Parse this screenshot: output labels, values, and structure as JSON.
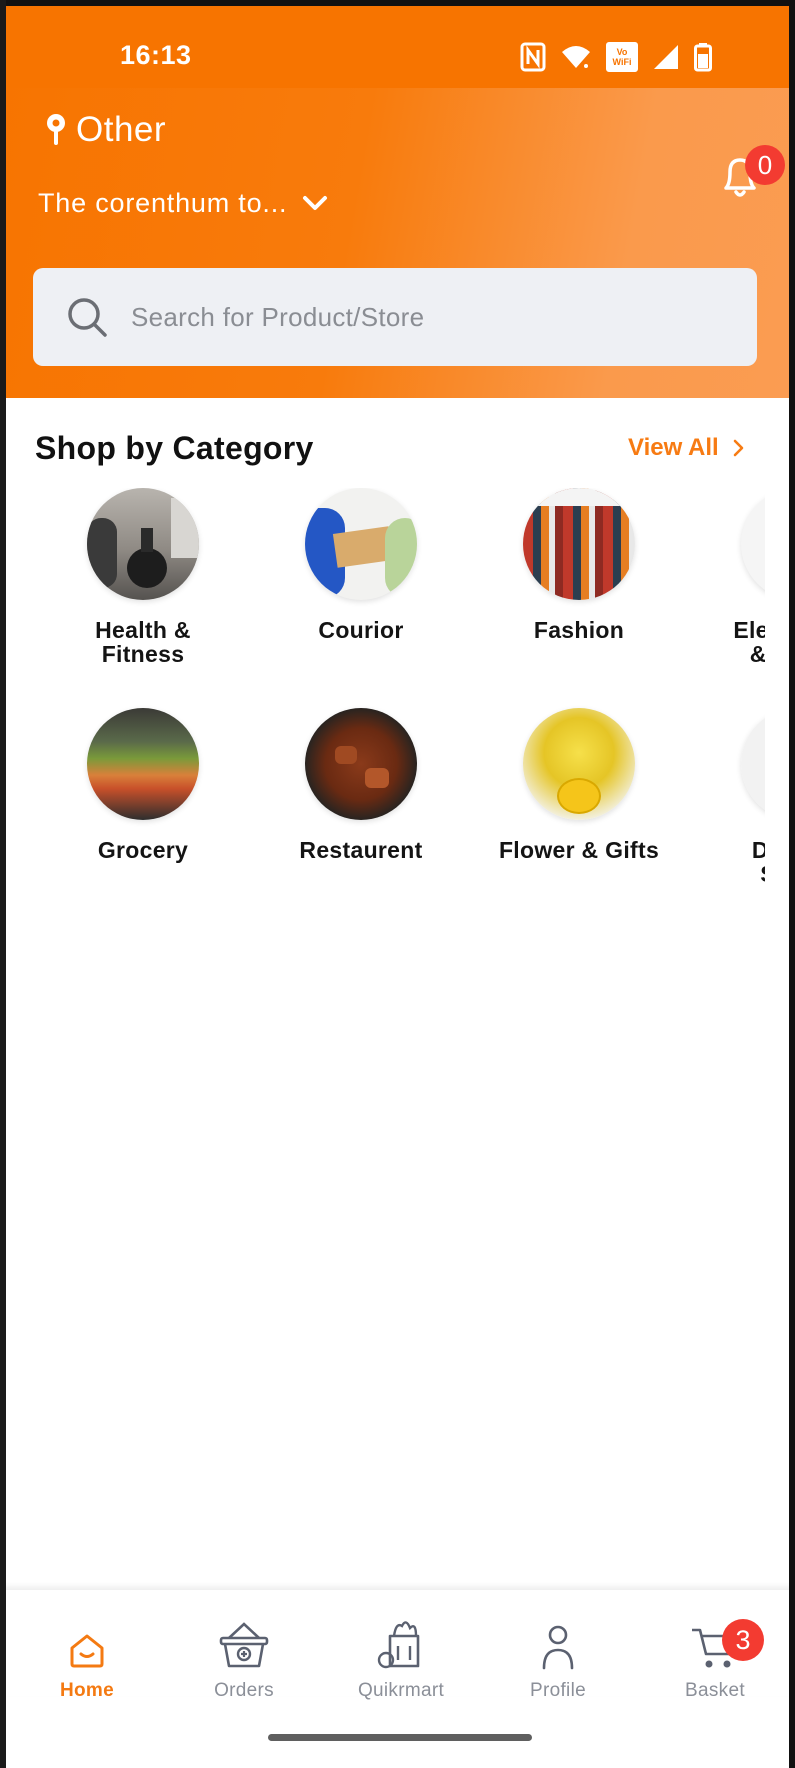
{
  "status_bar": {
    "time": "16:13",
    "icons": [
      "nfc-icon",
      "wifi-icon",
      "vowifi-icon",
      "signal-icon",
      "battery-icon"
    ],
    "vowifi_text": "Vo WiFi"
  },
  "location": {
    "label": "Other",
    "address": "The corenthum to...",
    "icon": "location-pin-icon"
  },
  "notifications": {
    "count": "0",
    "icon": "bell-icon"
  },
  "search": {
    "placeholder": "Search for Product/Store"
  },
  "section": {
    "title": "Shop by Category",
    "view_all": "View All"
  },
  "categories": [
    {
      "label": "Health & Fitness",
      "icon": "gym-image"
    },
    {
      "label": "Courior",
      "icon": "courier-image"
    },
    {
      "label": "Fashion",
      "icon": "clothes-rack-image"
    },
    {
      "label": "Electronics & Lights",
      "icon": "electronics-image"
    },
    {
      "label": "Grocery",
      "icon": "grocery-aisle-image"
    },
    {
      "label": "Restaurent",
      "icon": "curry-dish-image"
    },
    {
      "label": "Flower & Gifts",
      "icon": "flower-bouquet-image"
    },
    {
      "label": "Decor & Stores",
      "icon": "decor-image"
    }
  ],
  "tabs": [
    {
      "label": "Home",
      "icon": "home-icon",
      "active": true
    },
    {
      "label": "Orders",
      "icon": "orders-basket-icon",
      "active": false
    },
    {
      "label": "Quikrmart",
      "icon": "grocery-bag-icon",
      "active": false
    },
    {
      "label": "Profile",
      "icon": "profile-icon",
      "active": false
    },
    {
      "label": "Basket",
      "icon": "cart-icon",
      "active": false
    }
  ],
  "basket": {
    "count": "3"
  },
  "colors": {
    "brand_orange": "#f77400",
    "accent": "#f77b13",
    "badge_red": "#f33b31",
    "search_bg": "#eef0f4"
  }
}
